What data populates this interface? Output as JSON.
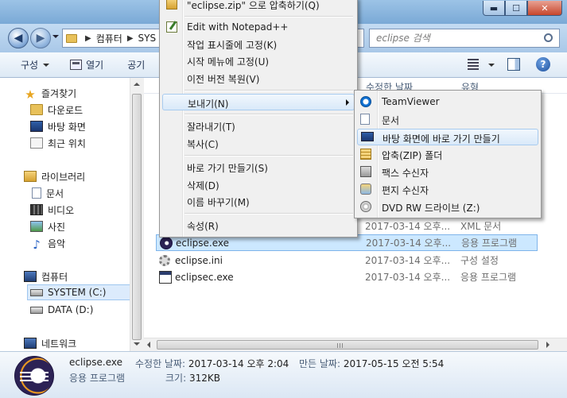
{
  "window": {
    "minimize": "▬",
    "maximize": "☐",
    "close": "✕"
  },
  "address": {
    "crumbs": [
      "컴퓨터",
      "SYS"
    ],
    "search_placeholder": "eclipse 검색"
  },
  "toolbar": {
    "organize": "구성",
    "open": "열기",
    "share": "공기"
  },
  "nav": {
    "favorites": "즐겨찾기",
    "downloads": "다운로드",
    "desktop": "바탕 화면",
    "recent": "최근 위치",
    "libraries": "라이브러리",
    "documents": "문서",
    "videos": "비디오",
    "pictures": "사진",
    "music": "음악",
    "computer": "컴퓨터",
    "system_drive": "SYSTEM (C:)",
    "data_drive": "DATA (D:)",
    "network": "네트워크"
  },
  "columns": {
    "date": "수정한 날짜",
    "type": "유형"
  },
  "files": [
    {
      "date": "2017-03-14 오후...",
      "type": "XML 문서"
    },
    {
      "name": "eclipse.exe",
      "date": "2017-03-14 오후...",
      "type": "응용 프로그램"
    },
    {
      "name": "eclipse.ini",
      "date": "2017-03-14 오후...",
      "type": "구성 설정"
    },
    {
      "name": "eclipsec.exe",
      "date": "2017-03-14 오후...",
      "type": "응용 프로그램"
    }
  ],
  "details": {
    "name": "eclipse.exe",
    "type": "응용 프로그램",
    "modified_label": "수정한 날짜:",
    "modified_value": "2017-03-14 오후 2:04",
    "created_label": "만든 날짜:",
    "created_value": "2017-05-15 오전 5:54",
    "size_label": "크기:",
    "size_value": "312KB"
  },
  "context_menu": {
    "zip_compress": "\"eclipse.zip\" 으로 압축하기(Q)",
    "edit_notepad": "Edit with Notepad++",
    "pin_taskbar": "작업 표시줄에 고정(K)",
    "pin_start": "시작 메뉴에 고정(U)",
    "restore_prev": "이전 버전 복원(V)",
    "send_to": "보내기(N)",
    "cut": "잘라내기(T)",
    "copy": "복사(C)",
    "create_shortcut": "바로 가기 만들기(S)",
    "delete": "삭제(D)",
    "rename": "이름 바꾸기(M)",
    "properties": "속성(R)"
  },
  "send_to_menu": {
    "teamviewer": "TeamViewer",
    "documents": "문서",
    "desktop_shortcut": "바탕 화면에 바로 가기 만들기",
    "zip_folder": "압축(ZIP) 폴더",
    "fax": "팩스 수신자",
    "mail": "편지 수신자",
    "dvd": "DVD RW 드라이브 (Z:)"
  }
}
